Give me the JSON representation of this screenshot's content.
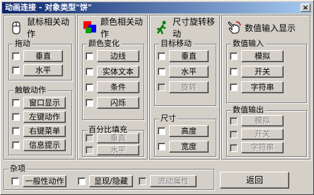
{
  "window": {
    "title": "动画连接 - 对象类型\"饼\"",
    "close_label": "×"
  },
  "mouse_panel": {
    "title": "鼠标相关动作",
    "icon": "mouse-icon",
    "drag_group": {
      "label": "拖动",
      "items": [
        {
          "label": "垂直"
        },
        {
          "label": "水平"
        }
      ]
    },
    "touch_group": {
      "label": "触敏动作",
      "items": [
        {
          "label": "窗口显示"
        },
        {
          "label": "左键动作"
        },
        {
          "label": "右键菜单"
        },
        {
          "label": "信息提示"
        }
      ]
    }
  },
  "color_panel": {
    "title": "颜色相关动作",
    "icon": "color-squares-icon",
    "color_group": {
      "label": "颜色变化",
      "items": [
        {
          "label": "边线"
        },
        {
          "label": "实体文本"
        },
        {
          "label": "条件"
        },
        {
          "label": "闪烁"
        }
      ]
    },
    "fill_group": {
      "label": "百分比填充",
      "items": [
        {
          "label": "垂直"
        },
        {
          "label": "水平"
        }
      ]
    }
  },
  "size_panel": {
    "title": "尺寸旋转移动",
    "icon": "running-man-icon",
    "move_group": {
      "label": "目标移动",
      "items": [
        {
          "label": "垂直"
        },
        {
          "label": "水平"
        },
        {
          "label": "旋转"
        }
      ]
    },
    "size_group": {
      "label": "尺寸",
      "items": [
        {
          "label": "高度"
        },
        {
          "label": "宽度"
        }
      ]
    }
  },
  "value_panel": {
    "title": "数值输入显示",
    "icon": "hand-pointer-icon",
    "input_group": {
      "label": "数值输入",
      "items": [
        {
          "label": "模拟"
        },
        {
          "label": "开关"
        },
        {
          "label": "字符串"
        }
      ]
    },
    "output_group": {
      "label": "数值输出",
      "items": [
        {
          "label": "模拟"
        },
        {
          "label": "开关"
        },
        {
          "label": "字符串"
        }
      ]
    }
  },
  "misc": {
    "label": "杂项",
    "items": [
      {
        "label": "一般性动作"
      },
      {
        "label": "显现/隐藏"
      },
      {
        "label": "流动属性"
      }
    ]
  },
  "return_button": "返回"
}
